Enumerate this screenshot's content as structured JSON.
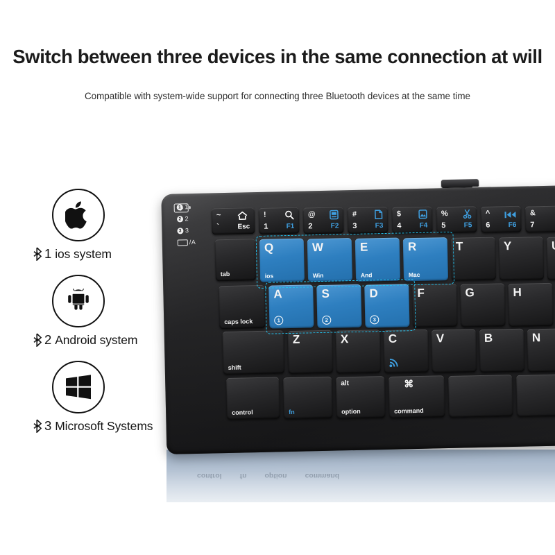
{
  "header": {
    "headline": "Switch between three devices in the same connection at will",
    "subtitle": "Compatible with system-wide support for connecting three Bluetooth devices at the same time"
  },
  "os_list": [
    {
      "icon": "apple-icon",
      "bt": "ᛦ",
      "number": "1",
      "label": "ios system"
    },
    {
      "icon": "android-icon",
      "bt": "ᛦ",
      "number": "2",
      "label": "Android system"
    },
    {
      "icon": "windows-icon",
      "bt": "ᛦ",
      "number": "3",
      "label": "Microsoft Systems"
    }
  ],
  "keyboard": {
    "battery_icon": "battery-charging-icon",
    "indicators": [
      {
        "dot": "1",
        "label": "1"
      },
      {
        "dot": "2",
        "label": "2"
      },
      {
        "dot": "3",
        "label": "3"
      },
      {
        "dot": "",
        "label": "/A"
      }
    ],
    "function_row": [
      {
        "name": "esc",
        "top": "~",
        "bottom": "`",
        "icon": "home-icon",
        "fn": "Esc"
      },
      {
        "name": "1",
        "top": "!",
        "bottom": "1",
        "icon": "search-icon",
        "fn": "F1"
      },
      {
        "name": "2",
        "top": "@",
        "bottom": "2",
        "icon": "display-icon",
        "fn": "F2"
      },
      {
        "name": "3",
        "top": "#",
        "bottom": "3",
        "icon": "document-icon",
        "fn": "F3"
      },
      {
        "name": "4",
        "top": "$",
        "bottom": "4",
        "icon": "image-icon",
        "fn": "F4"
      },
      {
        "name": "5",
        "top": "%",
        "bottom": "5",
        "icon": "scissors-icon",
        "fn": "F5"
      },
      {
        "name": "6",
        "top": "^",
        "bottom": "6",
        "icon": "previous-track-icon",
        "fn": "F6"
      },
      {
        "name": "7",
        "top": "&",
        "bottom": "7",
        "icon": "",
        "fn": ""
      }
    ],
    "row_q": {
      "tab": "tab",
      "keys": [
        {
          "main": "Q",
          "sub": "ios",
          "highlight": true
        },
        {
          "main": "W",
          "sub": "Win",
          "highlight": true
        },
        {
          "main": "E",
          "sub": "And",
          "highlight": true
        },
        {
          "main": "R",
          "sub": "Mac",
          "highlight": true
        },
        {
          "main": "T",
          "sub": "",
          "highlight": false
        },
        {
          "main": "Y",
          "sub": "",
          "highlight": false
        },
        {
          "main": "U",
          "sub": "",
          "highlight": false
        }
      ]
    },
    "row_a": {
      "caps": "caps lock",
      "keys": [
        {
          "main": "A",
          "sub": "1",
          "highlight": true
        },
        {
          "main": "S",
          "sub": "2",
          "highlight": true
        },
        {
          "main": "D",
          "sub": "3",
          "highlight": true
        },
        {
          "main": "F",
          "sub": "",
          "highlight": false
        },
        {
          "main": "G",
          "sub": "",
          "highlight": false
        },
        {
          "main": "H",
          "sub": "",
          "highlight": false
        }
      ]
    },
    "row_z": {
      "shift": "shift",
      "keys": [
        {
          "main": "Z",
          "glyph": ""
        },
        {
          "main": "X",
          "glyph": ""
        },
        {
          "main": "C",
          "glyph": "wireless-icon"
        },
        {
          "main": "V",
          "glyph": ""
        },
        {
          "main": "B",
          "glyph": ""
        },
        {
          "main": "N",
          "glyph": ""
        }
      ]
    },
    "row_bottom": {
      "control": "control",
      "fn": "fn",
      "alt_top": "alt",
      "alt_bottom": "option",
      "cmd_top": "⌘",
      "cmd_bottom": "command"
    }
  },
  "reflection": {
    "labels": [
      "control",
      "fn",
      "option",
      "command"
    ]
  },
  "colors": {
    "highlight_blue": "#2e7fc0",
    "dash_cyan": "#22c3f0",
    "legend_blue": "#3f9fe0",
    "key_dark": "#232325",
    "reflection": "#b4c2d3"
  }
}
